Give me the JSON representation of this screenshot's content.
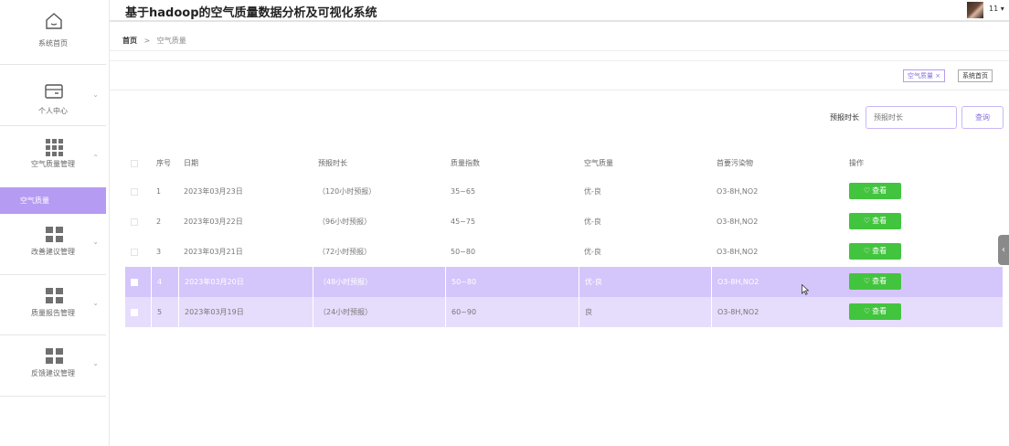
{
  "app": {
    "title": "基于hadoop的空气质量数据分析及可视化系统",
    "user": "11 ▾"
  },
  "sidebar": {
    "items": [
      {
        "label": "系统首页",
        "icon": "home-icon"
      },
      {
        "label": "个人中心",
        "icon": "wallet-icon"
      },
      {
        "label": "空气质量管理",
        "icon": "grid-icon"
      },
      {
        "label": "改善建议管理",
        "icon": "grid-icon"
      },
      {
        "label": "质量报告管理",
        "icon": "grid-icon"
      },
      {
        "label": "反馈建议管理",
        "icon": "grid-icon"
      }
    ],
    "active_sub": "空气质量"
  },
  "breadcrumb": {
    "home": "首页",
    "sep": ">",
    "current": "空气质量"
  },
  "tags": {
    "active": "空气质量 ×",
    "home": "系统首页"
  },
  "search": {
    "label": "预报时长",
    "placeholder": "预报时长",
    "button": "查询"
  },
  "table": {
    "headers": [
      "序号",
      "日期",
      "预报时长",
      "质量指数",
      "空气质量",
      "首要污染物",
      "操作"
    ],
    "rows": [
      {
        "no": "1",
        "date": "2023年03月23日",
        "duration": "（120小时预报）",
        "index": "35~65",
        "quality": "优-良",
        "pollutant": "O3-8H,NO2"
      },
      {
        "no": "2",
        "date": "2023年03月22日",
        "duration": "（96小时预报）",
        "index": "45~75",
        "quality": "优-良",
        "pollutant": "O3-8H,NO2"
      },
      {
        "no": "3",
        "date": "2023年03月21日",
        "duration": "（72小时预报）",
        "index": "50~80",
        "quality": "优-良",
        "pollutant": "O3-8H,NO2"
      },
      {
        "no": "4",
        "date": "2023年03月20日",
        "duration": "（48小时预报）",
        "index": "50~80",
        "quality": "优-良",
        "pollutant": "O3-8H,NO2"
      },
      {
        "no": "5",
        "date": "2023年03月19日",
        "duration": "（24小时预报）",
        "index": "60~90",
        "quality": "良",
        "pollutant": "O3-8H,NO2"
      }
    ],
    "view_label": "查看"
  },
  "colors": {
    "accent": "#b59bf2",
    "view_button": "#43c43f",
    "selected_row": "#d4c6fa",
    "hover_row": "#e6ddfc"
  }
}
